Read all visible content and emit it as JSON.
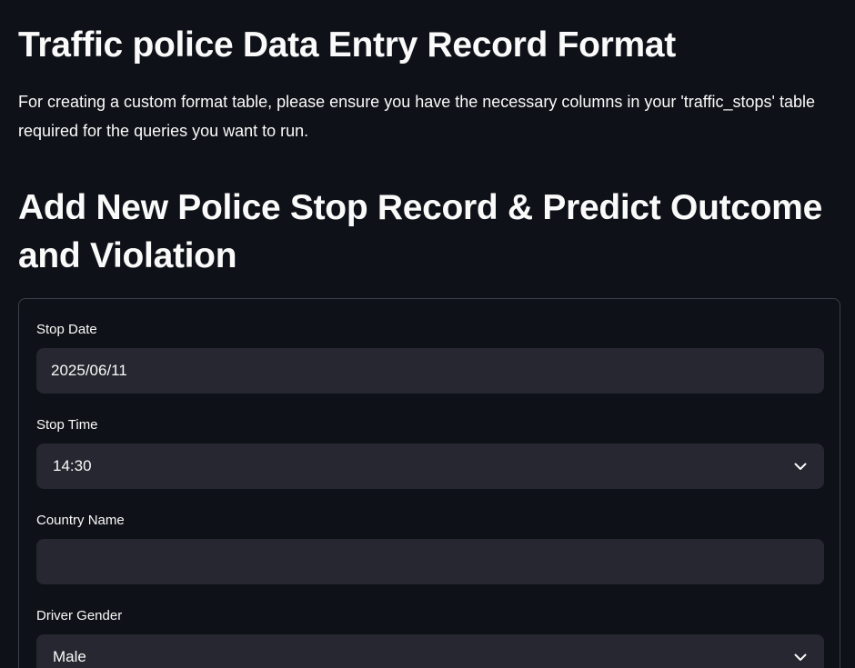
{
  "header": {
    "title": "Traffic police Data Entry Record Format",
    "intro": "For creating a custom format table, please ensure you have the necessary columns in your 'traffic_stops' table required for the queries you want to run."
  },
  "form": {
    "heading": "Add New Police Stop Record & Predict Outcome and Violation",
    "fields": {
      "stop_date": {
        "label": "Stop Date",
        "value": "2025/06/11"
      },
      "stop_time": {
        "label": "Stop Time",
        "value": "14:30",
        "icon": "chevron-down-icon"
      },
      "country_name": {
        "label": "Country Name",
        "value": ""
      },
      "driver_gender": {
        "label": "Driver Gender",
        "value": "Male",
        "icon": "chevron-down-icon"
      }
    }
  },
  "colors": {
    "background": "#0e1117",
    "input_background": "#262730",
    "border": "#3d3f48",
    "text": "#fafafa"
  }
}
